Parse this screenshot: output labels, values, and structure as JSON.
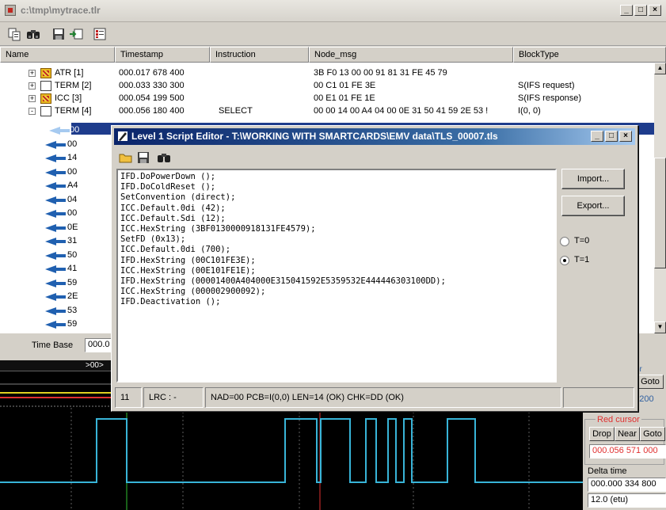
{
  "window": {
    "title": "c:\\tmp\\mytrace.tlr",
    "buttons": [
      "_",
      "□",
      "×"
    ]
  },
  "toolbar": {
    "icons": [
      "copy-icon",
      "find-icon",
      "save-icon",
      "export-icon",
      "tree-view-icon"
    ]
  },
  "columns": [
    "Name",
    "Timestamp",
    "Instruction",
    "Node_msg",
    "BlockType"
  ],
  "tree": {
    "top_rows": [
      {
        "expander": "+",
        "icon": "atr",
        "name": "ATR [1]",
        "timestamp": "000.017 678 400",
        "instruction": "",
        "node_msg": "3B F0 13 00 00 91 81 31 FE 45 79",
        "blocktype": ""
      },
      {
        "expander": "+",
        "icon": "term",
        "name": "TERM [2]",
        "timestamp": "000.033 330 300",
        "instruction": "",
        "node_msg": "00 C1 01 FE 3E",
        "blocktype": "S(IFS request)"
      },
      {
        "expander": "+",
        "icon": "atr",
        "name": "ICC [3]",
        "timestamp": "000.054 199 500",
        "instruction": "",
        "node_msg": "00 E1 01 FE 1E",
        "blocktype": "S(IFS response)"
      },
      {
        "expander": "-",
        "icon": "term",
        "name": "TERM [4]",
        "timestamp": "000.056 180 400",
        "instruction": "SELECT",
        "node_msg": "00 00 14 00 A4 04 00 0E 31 50 41 59 2E 53 !",
        "blocktype": "I(0, 0)"
      }
    ],
    "byte_rows": [
      "00",
      "00",
      "14",
      "00",
      "A4",
      "04",
      "00",
      "0E",
      "31",
      "50",
      "41",
      "59",
      "2E",
      "53",
      "59"
    ]
  },
  "timebase": {
    "label": "Time Base",
    "value": "000.0"
  },
  "wave": {
    "marker_label": ">00>"
  },
  "right_panel": {
    "top_partial_label": "or",
    "goto_top": "Goto",
    "top_field_partial": "36 200",
    "red_cursor_label": "Red cursor",
    "drop": "Drop",
    "near": "Near",
    "goto": "Goto",
    "red_cursor_value": "000.056 571 000",
    "delta_label": "Delta time",
    "delta_value": "000.000 334 800",
    "etu_value": "12.0 (etu)"
  },
  "dialog": {
    "title": "Level 1 Script Editor - T:\\WORKING WITH SMARTCARDS\\EMV data\\TLS_00007.tls",
    "buttons": [
      "_",
      "□",
      "×"
    ],
    "toolbar_icons": [
      "open-folder-icon",
      "save-icon",
      "find-icon"
    ],
    "code": [
      "IFD.DoPowerDown ();",
      "IFD.DoColdReset ();",
      "SetConvention (direct);",
      "ICC.Default.0di (42);",
      "ICC.Default.Sdi (12);",
      "ICC.HexString (3BF0130000918131FE4579);",
      "SetFD (0x13);",
      "ICC.Default.0di (700);",
      "IFD.HexString (00C101FE3E);",
      "ICC.HexString (00E101FE1E);",
      "IFD.HexString (00001400A404000E315041592E5359532E444446303100DD);",
      "ICC.HexString (000002900092);",
      "IFD.Deactivation ();"
    ],
    "import_label": "Import...",
    "export_label": "Export...",
    "radio_t0": "T=0",
    "radio_t1": "T=1",
    "selected_protocol": "T=1",
    "status_line": "11",
    "status_lrc": "LRC : -",
    "status_msg": "NAD=00 PCB=I(0,0) LEN=14 (OK) CHK=DD (OK)"
  },
  "colors": {
    "selection": "#1e3c8c",
    "waveform": "#38b4d8",
    "dialog_title_start": "#0a246a",
    "dialog_title_end": "#a6caf0",
    "red_cursor": "#e03030",
    "green_cursor": "#30c030",
    "yellow_line": "#e0d020"
  }
}
